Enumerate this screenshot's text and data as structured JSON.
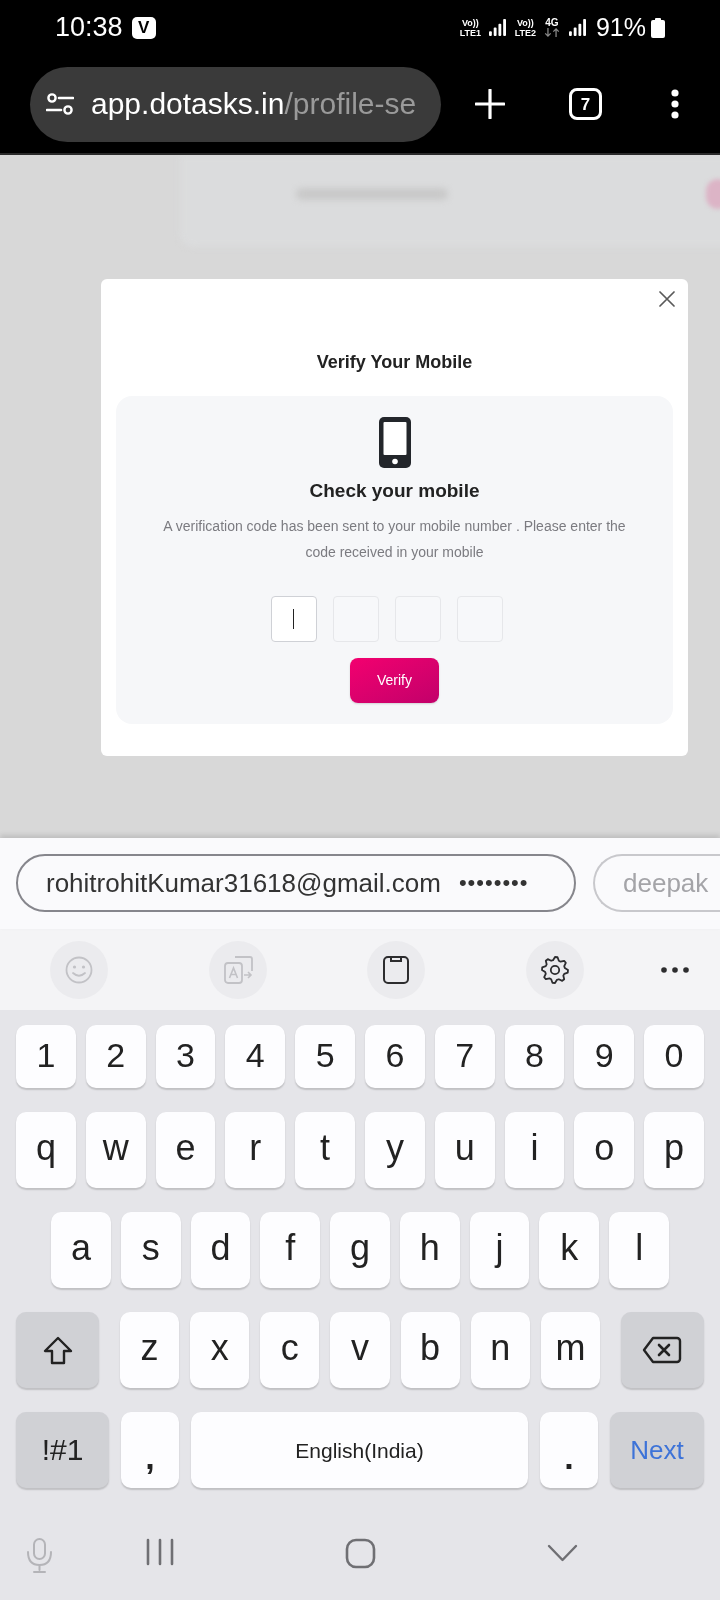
{
  "status_bar": {
    "time": "10:38",
    "notification_badge": "V",
    "sim_1": {
      "volte": "Vo))",
      "network": "LTE1"
    },
    "sim_2": {
      "volte": "Vo))",
      "network": "LTE2",
      "data_type": "4G"
    },
    "battery": "91%"
  },
  "browser_toolbar": {
    "url_host": "app.dotasks.in",
    "url_path": "/profile-se",
    "tab_count": "7"
  },
  "dialog": {
    "title": "Verify Your Mobile",
    "heading": "Check your mobile",
    "message": "A verification code has been sent to your mobile number . Please enter the code received in your mobile",
    "otp_fields": [
      {
        "focused": true
      },
      {
        "focused": false
      },
      {
        "focused": false
      },
      {
        "focused": false
      }
    ],
    "verify_button": "Verify"
  },
  "keyboard": {
    "autofill_suggestions": [
      {
        "account": "rohitrohitKumar31618@gmail.com",
        "password": "••••••••"
      },
      {
        "account": "deepak"
      }
    ],
    "toolbar": [
      {
        "kind": "emoji",
        "disabled": true
      },
      {
        "kind": "translate",
        "disabled": true
      },
      {
        "kind": "clipboard",
        "disabled": false
      },
      {
        "kind": "settings",
        "disabled": false
      },
      {
        "kind": "more",
        "disabled": false
      }
    ],
    "key_rows": [
      {
        "keys": [
          {
            "kind": "char",
            "label": "1"
          },
          {
            "kind": "char",
            "label": "2"
          },
          {
            "kind": "char",
            "label": "3"
          },
          {
            "kind": "char",
            "label": "4"
          },
          {
            "kind": "char",
            "label": "5"
          },
          {
            "kind": "char",
            "label": "6"
          },
          {
            "kind": "char",
            "label": "7"
          },
          {
            "kind": "char",
            "label": "8"
          },
          {
            "kind": "char",
            "label": "9"
          },
          {
            "kind": "char",
            "label": "0"
          }
        ]
      },
      {
        "keys": [
          {
            "kind": "char",
            "label": "q"
          },
          {
            "kind": "char",
            "label": "w"
          },
          {
            "kind": "char",
            "label": "e"
          },
          {
            "kind": "char",
            "label": "r"
          },
          {
            "kind": "char",
            "label": "t"
          },
          {
            "kind": "char",
            "label": "y"
          },
          {
            "kind": "char",
            "label": "u"
          },
          {
            "kind": "char",
            "label": "i"
          },
          {
            "kind": "char",
            "label": "o"
          },
          {
            "kind": "char",
            "label": "p"
          }
        ]
      },
      {
        "keys": [
          {
            "kind": "char",
            "label": "a"
          },
          {
            "kind": "char",
            "label": "s"
          },
          {
            "kind": "char",
            "label": "d"
          },
          {
            "kind": "char",
            "label": "f"
          },
          {
            "kind": "char",
            "label": "g"
          },
          {
            "kind": "char",
            "label": "h"
          },
          {
            "kind": "char",
            "label": "j"
          },
          {
            "kind": "char",
            "label": "k"
          },
          {
            "kind": "char",
            "label": "l"
          }
        ]
      },
      {
        "keys": [
          {
            "kind": "shift"
          },
          {
            "kind": "char",
            "label": "z"
          },
          {
            "kind": "char",
            "label": "x"
          },
          {
            "kind": "char",
            "label": "c"
          },
          {
            "kind": "char",
            "label": "v"
          },
          {
            "kind": "char",
            "label": "b"
          },
          {
            "kind": "char",
            "label": "n"
          },
          {
            "kind": "char",
            "label": "m"
          },
          {
            "kind": "backspace"
          }
        ]
      },
      {
        "keys": [
          {
            "kind": "mode",
            "label": "!#1"
          },
          {
            "kind": "punct",
            "label": ","
          },
          {
            "kind": "space",
            "label": "English(India)"
          },
          {
            "kind": "punct",
            "label": "."
          },
          {
            "kind": "action",
            "label": "Next"
          }
        ]
      }
    ]
  }
}
